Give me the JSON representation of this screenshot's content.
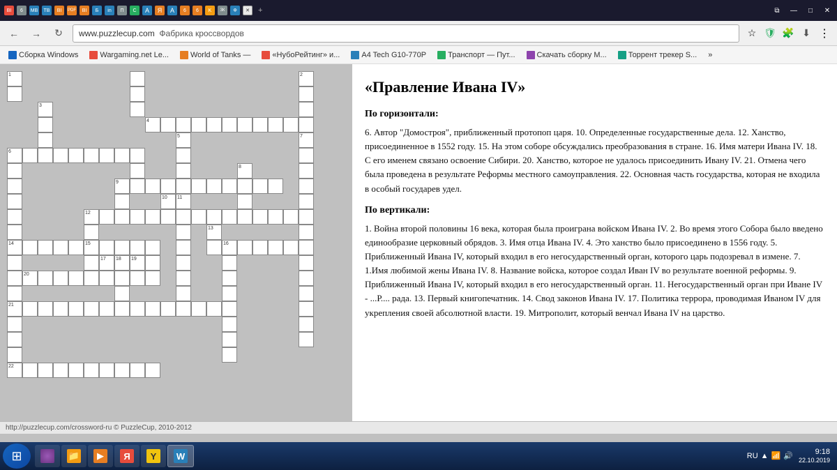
{
  "titleBar": {
    "tabs": [
      {
        "label": "BI",
        "color": "yt"
      },
      {
        "label": "6",
        "color": "gray"
      },
      {
        "label": "MB",
        "color": "blue"
      },
      {
        "label": "TB",
        "color": "blue"
      },
      {
        "label": "BI",
        "color": "orange"
      },
      {
        "label": "PDF",
        "color": "orange"
      },
      {
        "label": "BI",
        "color": "orange"
      },
      {
        "label": "Б",
        "color": "blue"
      },
      {
        "label": "in",
        "color": "blue"
      },
      {
        "label": "П",
        "color": "gray"
      },
      {
        "label": "С",
        "color": "green"
      },
      {
        "label": "А",
        "color": "blue"
      },
      {
        "label": "Я",
        "color": "orange"
      },
      {
        "label": "А",
        "color": "blue"
      },
      {
        "label": "6",
        "color": "orange"
      },
      {
        "label": "6",
        "color": "orange"
      },
      {
        "label": "K",
        "color": "yellow"
      },
      {
        "label": "3К",
        "color": "gray"
      },
      {
        "label": "Ф",
        "color": "blue"
      },
      {
        "label": "✕",
        "active": true
      }
    ],
    "winButtons": [
      "⧉",
      "—",
      "□",
      "✕"
    ]
  },
  "addressBar": {
    "url": "www.puzzlecup.com",
    "pageTitle": "Фабрика кроссвордов",
    "navButtons": [
      "←",
      "→",
      "↻"
    ]
  },
  "bookmarks": [
    {
      "label": "Сборка Windows",
      "icon": "🪟"
    },
    {
      "label": "Wargaming.net Le...",
      "icon": "🎮"
    },
    {
      "label": "World of Tanks —",
      "icon": "🎮"
    },
    {
      "label": "«НубоРейтинг» и...",
      "icon": "🏆"
    },
    {
      "label": "A4 Tech G10-770P",
      "icon": "🖱"
    },
    {
      "label": "Транспорт — Пут...",
      "icon": "🚗"
    },
    {
      "label": "Скачать сборку М...",
      "icon": "📦"
    },
    {
      "label": "Торрент трекер S...",
      "icon": "⬇"
    },
    {
      "label": "»",
      "icon": ""
    }
  ],
  "crossword": {
    "title": "«Правление Ивана IV»",
    "horizontal_title": "По горизонтали:",
    "horizontal_clues": "6. Автор \"Домостроя\", приближенный протопоп царя.   10. Определенные государственные дела.   12. Ханство, присоединенное в 1552 году.   15. На этом соборе обсуждались преобразования в стране.   16. Имя матери Ивана IV.   18. С его именем связано освоение Сибири.   20. Ханство, которое не удалось присоединить Ивану IV.   21. Отмена чего была проведена в результате Реформы местного самоуправления.   22. Основная часть государства, которая не входила в особый государев удел.",
    "vertical_title": "По вертикали:",
    "vertical_clues": "1. Война второй половины 16 века, которая была проиграна войском Ивана IV.   2. Во время этого Собора было введено единообразие церковный обрядов.   3. Имя отца Ивана IV.   4. Это ханство было присоединено в 1556 году.   5. Приближенный Ивана IV, который входил в его негосударственный орган, которого царь подозревал в измене.   7. 1.Имя любимой жены Ивана IV.   8. Название войска, которое создал Иван IV во результате военной реформы.   9. Приближенный Ивана IV, который входил в его негосударственный орган.   11. Негосударственный орган при Иване IV - ...Р.... рада.   13. Первый книгопечатник.   14. Свод законов Ивана IV.   17. Политика террора, проводимая Иваном IV для укрепления своей абсолютной власти.   19. Митрополит, который венчал Ивана IV на царство."
  },
  "statusBar": {
    "url": "http://puzzlecup.com/crossword-ru © PuzzleCup, 2010-2012"
  },
  "taskbar": {
    "startBtn": "⊞",
    "buttons": [
      {
        "label": "🪟",
        "type": "start"
      },
      {
        "label": "🔵",
        "color": "purple"
      },
      {
        "label": "📁",
        "color": "orange"
      },
      {
        "label": "▶",
        "color": "blue"
      },
      {
        "label": "Я",
        "color": "red"
      },
      {
        "label": "Y",
        "color": "yellow"
      },
      {
        "label": "W",
        "color": "blue"
      }
    ],
    "tray": {
      "lang": "RU",
      "time": "9:18",
      "date": "22.10.2019"
    }
  }
}
